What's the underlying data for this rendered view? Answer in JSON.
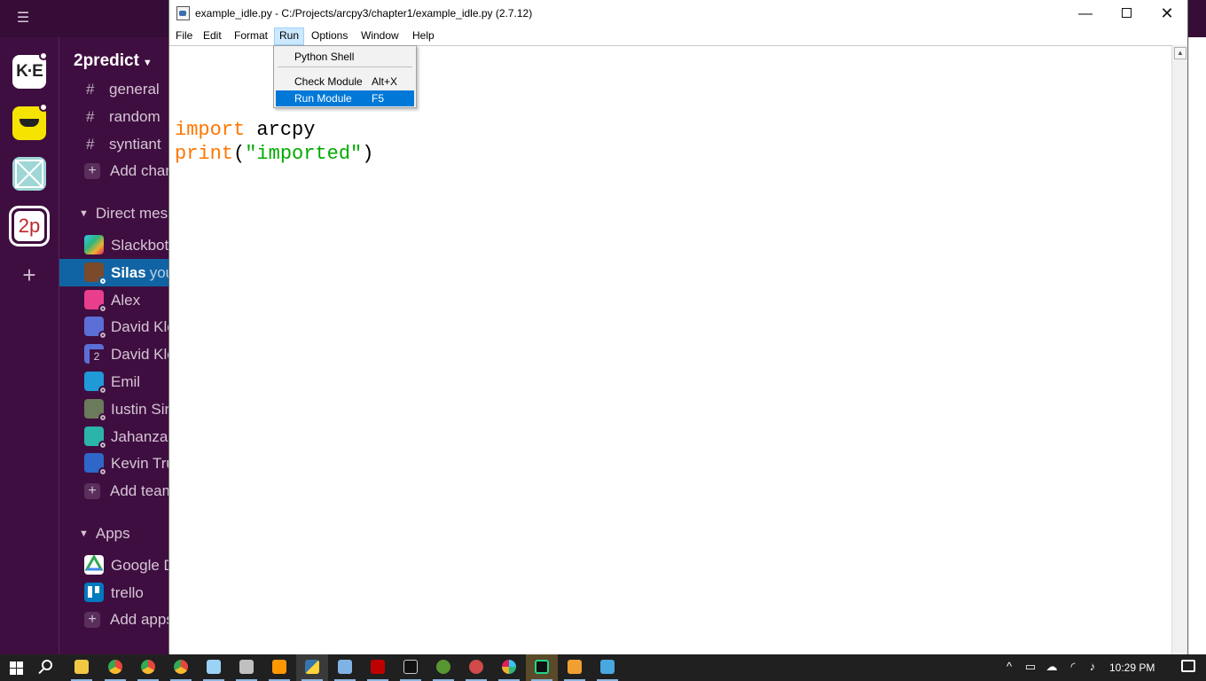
{
  "slack": {
    "workspace_name": "2predict",
    "workspaces": [
      {
        "label": "K·E",
        "name": "ke"
      },
      {
        "label": "",
        "name": "yellow-workspace"
      },
      {
        "label": "",
        "name": "cross-workspace"
      },
      {
        "label": "2p",
        "name": "2predict"
      }
    ],
    "channels": [
      "general",
      "random",
      "syntiant"
    ],
    "add_channels": "Add channels",
    "dm_section": "Direct messages",
    "dms": [
      {
        "name": "Slackbot",
        "color": "#e01e5a"
      },
      {
        "name": "Silas",
        "suffix": "you",
        "color": "#7a4a2a"
      },
      {
        "name": "Alex",
        "color": "#e83e8c"
      },
      {
        "name": "David Klein",
        "color": "#5b6fd6"
      },
      {
        "name": "David Klein",
        "color": "#5b6fd6",
        "badge": "2"
      },
      {
        "name": "Emil",
        "color": "#1f9ad6"
      },
      {
        "name": "Iustin Sirbu",
        "color": "#6b7a5a"
      },
      {
        "name": "Jahanzaib",
        "color": "#2bb5a8"
      },
      {
        "name": "Kevin Truong",
        "color": "#2f67c9"
      }
    ],
    "add_teammates": "Add teammates",
    "apps_section": "Apps",
    "apps": [
      {
        "name": "Google Drive",
        "color": "#34a853"
      },
      {
        "name": "trello",
        "color": "#0079bf"
      }
    ],
    "add_apps": "Add apps"
  },
  "idle": {
    "title": "example_idle.py - C:/Projects/arcpy3/chapter1/example_idle.py (2.7.12)",
    "menu": [
      "File",
      "Edit",
      "Format",
      "Run",
      "Options",
      "Window",
      "Help"
    ],
    "open_menu": "Run",
    "run_menu": [
      {
        "label": "Python Shell",
        "shortcut": ""
      },
      {
        "label": "Check Module",
        "shortcut": "Alt+X"
      },
      {
        "label": "Run Module",
        "shortcut": "F5",
        "highlighted": true
      }
    ],
    "code": {
      "line1": {
        "keyword": "import",
        "rest": " arcpy"
      },
      "line2": {
        "builtin": "print",
        "open": "(",
        "string": "\"imported\"",
        "close": ")"
      }
    }
  },
  "taskbar": {
    "clock": "10:29 PM",
    "apps": [
      {
        "name": "file-explorer",
        "color": "#f2c744"
      },
      {
        "name": "chrome",
        "color": "#e8453c"
      },
      {
        "name": "chrome-2",
        "color": "#e8453c"
      },
      {
        "name": "chrome-3",
        "color": "#e8453c"
      },
      {
        "name": "notepad",
        "color": "#9ad3f5"
      },
      {
        "name": "tool",
        "color": "#c0c0c0"
      },
      {
        "name": "sublime",
        "color": "#ff9800"
      },
      {
        "name": "python-idle",
        "color": "#3776ab"
      },
      {
        "name": "paint",
        "color": "#7fb3e6"
      },
      {
        "name": "filezilla",
        "color": "#bf0000"
      },
      {
        "name": "cmd",
        "color": "#111111"
      },
      {
        "name": "qgis",
        "color": "#589632"
      },
      {
        "name": "tool-2",
        "color": "#d04a4a"
      },
      {
        "name": "slack",
        "color": "#ffffff"
      },
      {
        "name": "pycharm",
        "color": "#21d789"
      },
      {
        "name": "app",
        "color": "#f0a030"
      },
      {
        "name": "monitor",
        "color": "#4aa8e0"
      }
    ]
  }
}
